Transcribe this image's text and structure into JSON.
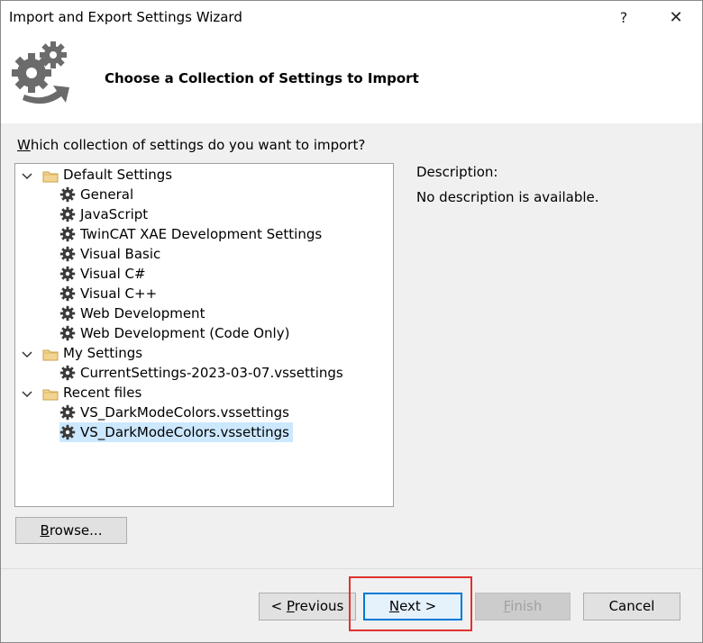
{
  "window": {
    "title": "Import and Export Settings Wizard",
    "help_label": "?",
    "close_label": "✕"
  },
  "header": {
    "title": "Choose a Collection of Settings to Import",
    "icon": "gears-arrow-icon"
  },
  "question": {
    "prefix": "W",
    "rest": "hich collection of settings do you want to import?"
  },
  "tree": {
    "groups": [
      {
        "label": "Default Settings",
        "items": [
          "General",
          "JavaScript",
          "TwinCAT XAE Development Settings",
          "Visual Basic",
          "Visual C#",
          "Visual C++",
          "Web Development",
          "Web Development (Code Only)"
        ]
      },
      {
        "label": "My Settings",
        "items": [
          "CurrentSettings-2023-03-07.vssettings"
        ]
      },
      {
        "label": "Recent files",
        "items": [
          "VS_DarkModeColors.vssettings",
          "VS_DarkModeColors.vssettings"
        ]
      }
    ],
    "selected": "VS_DarkModeColors.vssettings"
  },
  "description": {
    "label": "Description:",
    "text": "No description is available."
  },
  "browse": {
    "prefix": "B",
    "rest": "rowse..."
  },
  "buttons": {
    "previous": {
      "pre": "< ",
      "key": "P",
      "rest": "revious"
    },
    "next": {
      "key": "N",
      "rest": "ext >"
    },
    "finish": {
      "key": "F",
      "rest": "inish"
    },
    "cancel": "Cancel"
  },
  "colors": {
    "selection": "#cce8ff",
    "highlight_border": "#e0322e",
    "accent": "#0078d7"
  }
}
